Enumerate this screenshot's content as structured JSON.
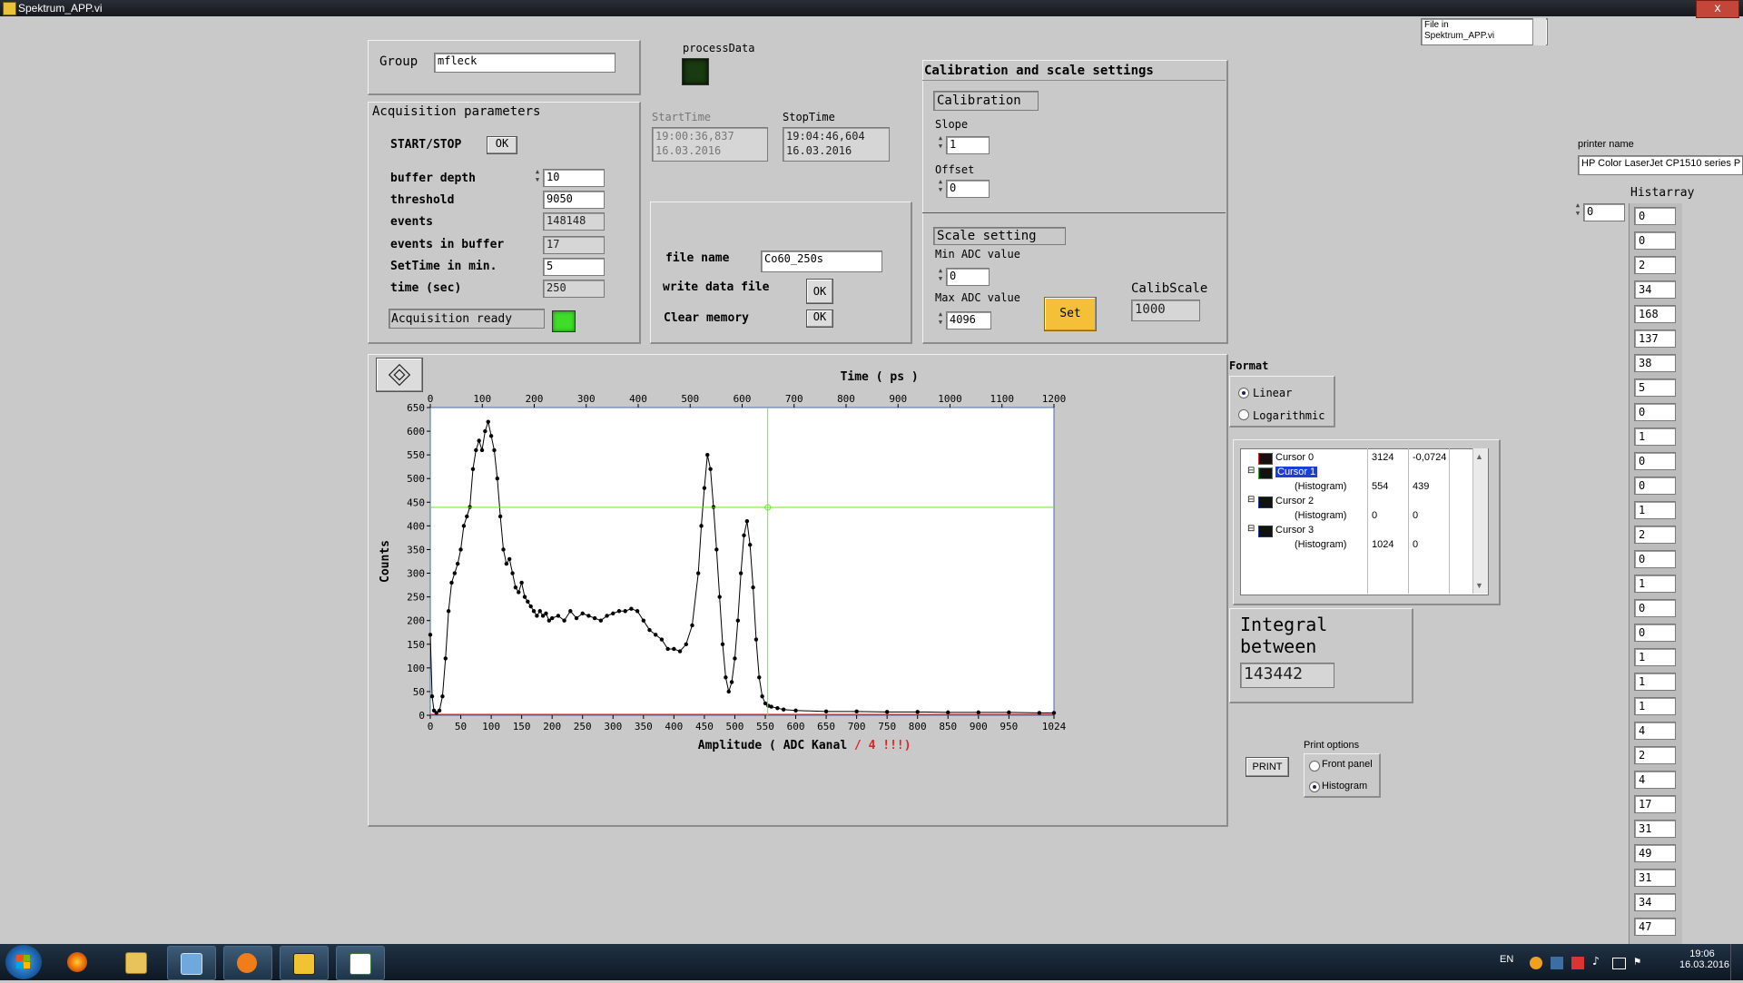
{
  "window": {
    "title": "Spektrum_APP.vi",
    "close": "x"
  },
  "file_list": {
    "line1": "File in",
    "line2": "Spektrum_APP.vi"
  },
  "group": {
    "label": "Group",
    "value": "mfleck"
  },
  "process_data": {
    "label": "processData",
    "led_color": "#1a3a10"
  },
  "acquisition": {
    "title": "Acquisition parameters",
    "start_stop_label": "START/STOP",
    "start_stop_btn": "OK",
    "buffer_depth_label": "buffer depth",
    "buffer_depth": "10",
    "threshold_label": "threshold",
    "threshold": "9050",
    "events_label": "events",
    "events": "148148",
    "events_buffer_label": "events in buffer",
    "events_buffer": "17",
    "settime_label": "SetTime in min.",
    "settime": "5",
    "time_label": "time (sec)",
    "time": "250",
    "ready_label": "Acquisition ready",
    "ready_led_color": "#3fdc2a"
  },
  "times": {
    "start_label": "StartTime",
    "start_time": "19:00:36,837",
    "start_date": "16.03.2016",
    "stop_label": "StopTime",
    "stop_time": "19:04:46,604",
    "stop_date": "16.03.2016"
  },
  "file_panel": {
    "file_name_label": "file name",
    "file_name": "Co60_250s",
    "write_label": "write data file",
    "write_btn": "OK",
    "clear_label": "Clear memory",
    "clear_btn": "OK"
  },
  "calibration": {
    "title": "Calibration and scale settings",
    "cal_label": "Calibration",
    "slope_label": "Slope",
    "slope": "1",
    "offset_label": "Offset",
    "offset": "0",
    "scale_label": "Scale setting",
    "min_label": "Min ADC value",
    "min": "0",
    "max_label": "Max ADC value",
    "max": "4096",
    "set_btn": "Set",
    "calibscale_label": "CalibScale",
    "calibscale": "1000"
  },
  "printer": {
    "label": "printer name",
    "value": "HP Color LaserJet CP1510 series P"
  },
  "histarray": {
    "label": "Histarray",
    "index": "0",
    "values": [
      "0",
      "0",
      "2",
      "34",
      "168",
      "137",
      "38",
      "5",
      "0",
      "1",
      "0",
      "0",
      "1",
      "2",
      "0",
      "1",
      "0",
      "0",
      "1",
      "1",
      "1",
      "4",
      "2",
      "4",
      "17",
      "31",
      "49",
      "31",
      "34",
      "47"
    ]
  },
  "format": {
    "label": "Format",
    "linear": "Linear",
    "log": "Logarithmic",
    "selected": "Linear"
  },
  "cursors": [
    {
      "name": "Cursor 0",
      "sub": "",
      "x": "3124",
      "y": "-0,0724",
      "color": "#cc2222"
    },
    {
      "name": "Cursor 1",
      "sub": "(Histogram)",
      "x": "554",
      "y": "439",
      "color": "#22aa22"
    },
    {
      "name": "Cursor 2",
      "sub": "(Histogram)",
      "x": "0",
      "y": "0",
      "color": "#223399"
    },
    {
      "name": "Cursor 3",
      "sub": "(Histogram)",
      "x": "1024",
      "y": "0",
      "color": "#223399"
    }
  ],
  "integral": {
    "label1": "Integral",
    "label2": "between",
    "value": "143442"
  },
  "print": {
    "button": "PRINT",
    "options_label": "Print options",
    "front": "Front panel",
    "histogram": "Histogram",
    "selected": "Histogram"
  },
  "taskbar": {
    "lang": "EN",
    "time": "19:06",
    "date": "16.03.2016"
  },
  "chart_data": {
    "type": "scatter",
    "title": "",
    "top_axis_label": "Time ( ps )",
    "xlabel": "Amplitude ( ADC Kanal",
    "xlabel_red": "/ 4 !!!)",
    "xlabel_end": ")",
    "ylabel": "Counts",
    "xlim": [
      0,
      1024
    ],
    "ylim": [
      0,
      650
    ],
    "top_xlim": [
      0,
      1200
    ],
    "x_ticks": [
      0,
      50,
      100,
      150,
      200,
      250,
      300,
      350,
      400,
      450,
      500,
      550,
      600,
      650,
      700,
      750,
      800,
      850,
      900,
      950,
      1024
    ],
    "top_ticks": [
      0,
      100,
      200,
      300,
      400,
      500,
      600,
      700,
      800,
      900,
      1000,
      1100,
      1200
    ],
    "y_ticks": [
      0,
      50,
      100,
      150,
      200,
      250,
      300,
      350,
      400,
      450,
      500,
      550,
      600,
      650
    ],
    "cursor": {
      "x": 554,
      "y": 439,
      "color": "#66ee22"
    },
    "series": [
      {
        "color": "#000000",
        "points": [
          [
            0,
            170
          ],
          [
            3,
            40
          ],
          [
            6,
            10
          ],
          [
            10,
            5
          ],
          [
            15,
            10
          ],
          [
            20,
            40
          ],
          [
            25,
            120
          ],
          [
            30,
            220
          ],
          [
            35,
            280
          ],
          [
            40,
            300
          ],
          [
            45,
            320
          ],
          [
            50,
            350
          ],
          [
            55,
            400
          ],
          [
            60,
            420
          ],
          [
            65,
            440
          ],
          [
            70,
            520
          ],
          [
            75,
            560
          ],
          [
            80,
            580
          ],
          [
            85,
            560
          ],
          [
            90,
            600
          ],
          [
            95,
            620
          ],
          [
            100,
            590
          ],
          [
            105,
            560
          ],
          [
            110,
            500
          ],
          [
            115,
            420
          ],
          [
            120,
            350
          ],
          [
            125,
            320
          ],
          [
            130,
            330
          ],
          [
            135,
            300
          ],
          [
            140,
            270
          ],
          [
            145,
            260
          ],
          [
            150,
            280
          ],
          [
            155,
            250
          ],
          [
            160,
            240
          ],
          [
            165,
            230
          ],
          [
            170,
            220
          ],
          [
            175,
            210
          ],
          [
            180,
            220
          ],
          [
            185,
            210
          ],
          [
            190,
            215
          ],
          [
            195,
            200
          ],
          [
            200,
            205
          ],
          [
            210,
            210
          ],
          [
            220,
            200
          ],
          [
            230,
            220
          ],
          [
            240,
            205
          ],
          [
            250,
            215
          ],
          [
            260,
            210
          ],
          [
            270,
            205
          ],
          [
            280,
            200
          ],
          [
            290,
            210
          ],
          [
            300,
            215
          ],
          [
            310,
            220
          ],
          [
            320,
            220
          ],
          [
            330,
            225
          ],
          [
            340,
            220
          ],
          [
            350,
            200
          ],
          [
            360,
            180
          ],
          [
            370,
            170
          ],
          [
            380,
            160
          ],
          [
            390,
            140
          ],
          [
            400,
            140
          ],
          [
            410,
            135
          ],
          [
            420,
            150
          ],
          [
            430,
            190
          ],
          [
            440,
            300
          ],
          [
            445,
            400
          ],
          [
            450,
            480
          ],
          [
            455,
            550
          ],
          [
            460,
            520
          ],
          [
            465,
            440
          ],
          [
            470,
            350
          ],
          [
            475,
            250
          ],
          [
            480,
            150
          ],
          [
            485,
            80
          ],
          [
            490,
            50
          ],
          [
            495,
            70
          ],
          [
            500,
            120
          ],
          [
            505,
            200
          ],
          [
            510,
            300
          ],
          [
            515,
            380
          ],
          [
            520,
            410
          ],
          [
            525,
            360
          ],
          [
            530,
            270
          ],
          [
            535,
            160
          ],
          [
            540,
            80
          ],
          [
            545,
            40
          ],
          [
            550,
            25
          ],
          [
            555,
            20
          ],
          [
            560,
            18
          ],
          [
            570,
            15
          ],
          [
            580,
            12
          ],
          [
            600,
            10
          ],
          [
            650,
            8
          ],
          [
            700,
            8
          ],
          [
            750,
            7
          ],
          [
            800,
            7
          ],
          [
            850,
            6
          ],
          [
            900,
            6
          ],
          [
            950,
            6
          ],
          [
            1000,
            5
          ],
          [
            1024,
            5
          ]
        ]
      }
    ]
  }
}
